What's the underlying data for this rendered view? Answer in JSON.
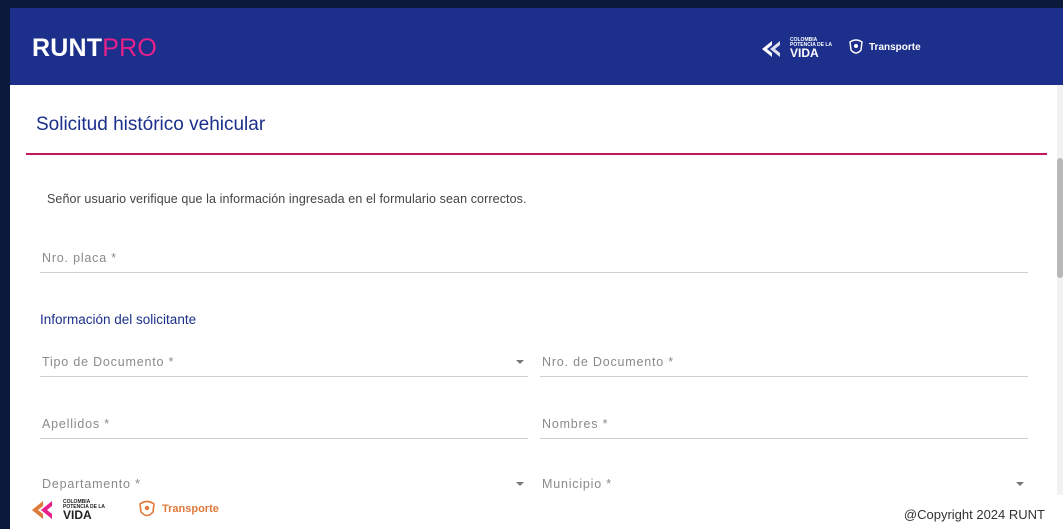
{
  "header": {
    "logo_main": "RUNT",
    "logo_accent": "PRO",
    "brand_vida_small": "COLOMBIA\nPOTENCIA DE LA",
    "brand_vida": "VIDA",
    "brand_transporte": "Transporte"
  },
  "page": {
    "title": "Solicitud histórico vehicular",
    "notice": "Señor usuario verifique que la información ingresada en el formulario sean correctos."
  },
  "form": {
    "placa_label": "Nro. placa *",
    "section_title": "Información del solicitante",
    "tipo_documento_label": "Tipo de Documento *",
    "nro_documento_label": "Nro. de Documento *",
    "apellidos_label": "Apellidos *",
    "nombres_label": "Nombres *",
    "departamento_label": "Departamento *",
    "municipio_label": "Municipio *"
  },
  "footer": {
    "brand_vida_small": "COLOMBIA\nPOTENCIA DE LA",
    "brand_vida": "VIDA",
    "brand_transporte": "Transporte",
    "copyright": "@Copyright 2024 RUNT"
  },
  "colors": {
    "header_bg": "#1b2f8b",
    "accent_pink": "#e8208a",
    "title_line": "#c2185b",
    "transporte_orange": "#e07a3a"
  }
}
